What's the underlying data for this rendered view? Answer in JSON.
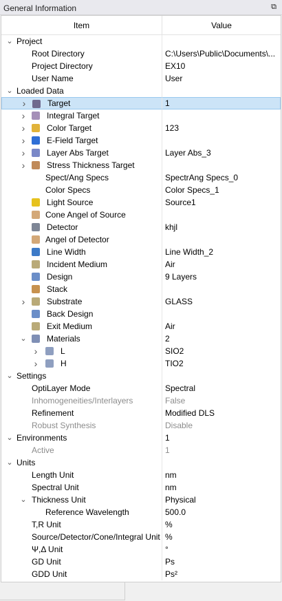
{
  "window": {
    "title": "General Information"
  },
  "columns": {
    "item": "Item",
    "value": "Value"
  },
  "rows": [
    {
      "level": 0,
      "chev": "down",
      "label": "Project",
      "value": ""
    },
    {
      "level": 1,
      "label": "Root Directory",
      "value": "C:\\Users\\Public\\Documents\\..."
    },
    {
      "level": 1,
      "label": "Project Directory",
      "value": "EX10"
    },
    {
      "level": 1,
      "label": "User Name",
      "value": "User"
    },
    {
      "level": 0,
      "chev": "down",
      "label": "Loaded Data",
      "value": ""
    },
    {
      "level": 1,
      "chev": "right",
      "icon": "target-icon",
      "icolor": "#6f6a8f",
      "label": "Target",
      "value": "1",
      "selected": true
    },
    {
      "level": 1,
      "chev": "right",
      "icon": "integral-target-icon",
      "icolor": "#a58fb8",
      "label": "Integral Target",
      "value": ""
    },
    {
      "level": 1,
      "chev": "right",
      "icon": "color-target-icon",
      "icolor": "#e1b33a",
      "label": "Color Target",
      "value": "123"
    },
    {
      "level": 1,
      "chev": "right",
      "icon": "e-field-target-icon",
      "icolor": "#2f6fd6",
      "label": "E-Field Target",
      "value": ""
    },
    {
      "level": 1,
      "chev": "right",
      "icon": "layer-abs-target-icon",
      "icolor": "#7a88c8",
      "label": "Layer Abs Target",
      "value": "Layer Abs_3"
    },
    {
      "level": 1,
      "chev": "right",
      "icon": "stress-thickness-target-icon",
      "icolor": "#c08a59",
      "label": "Stress Thickness Target",
      "value": ""
    },
    {
      "level": 2,
      "label": "Spect/Ang Specs",
      "value": "SpectrAng Specs_0"
    },
    {
      "level": 2,
      "label": "Color Specs",
      "value": "Color Specs_1"
    },
    {
      "level": 1,
      "icon": "light-source-icon",
      "icolor": "#e6c21e",
      "label": "Light Source",
      "value": "Source1"
    },
    {
      "level": 1,
      "icon": "cone-icon",
      "icolor": "#d3a878",
      "label": "Cone Angel of Source",
      "value": "",
      "shift": true
    },
    {
      "level": 1,
      "icon": "detector-icon",
      "icolor": "#7e8696",
      "label": "Detector",
      "value": "khjl"
    },
    {
      "level": 1,
      "icon": "cone-detector-icon",
      "icolor": "#d3a878",
      "label": "Angel of Detector",
      "value": "",
      "shift": true
    },
    {
      "level": 1,
      "icon": "line-width-icon",
      "icolor": "#3c7ac8",
      "label": "Line Width",
      "value": "Line Width_2"
    },
    {
      "level": 1,
      "icon": "incident-medium-icon",
      "icolor": "#b9aa78",
      "label": "Incident Medium",
      "value": "Air"
    },
    {
      "level": 1,
      "icon": "design-icon",
      "icolor": "#6b8ec8",
      "label": "Design",
      "value": "9 Layers"
    },
    {
      "level": 1,
      "icon": "stack-icon",
      "icolor": "#c7924f",
      "label": "Stack",
      "value": ""
    },
    {
      "level": 1,
      "chev": "right",
      "icon": "substrate-icon",
      "icolor": "#b9aa78",
      "label": "Substrate",
      "value": "GLASS"
    },
    {
      "level": 1,
      "icon": "back-design-icon",
      "icolor": "#6b8ec8",
      "label": "Back Design",
      "value": ""
    },
    {
      "level": 1,
      "icon": "exit-medium-icon",
      "icolor": "#b9aa78",
      "label": "Exit Medium",
      "value": "Air"
    },
    {
      "level": 1,
      "chev": "down",
      "icon": "materials-icon",
      "icolor": "#7f8fb5",
      "label": "Materials",
      "value": "2"
    },
    {
      "level": 2,
      "chev": "right",
      "icon": "material-icon",
      "icolor": "#8f9fc0",
      "label": "L",
      "value": "SIO2"
    },
    {
      "level": 2,
      "chev": "right",
      "icon": "material-icon",
      "icolor": "#8f9fc0",
      "label": "H",
      "value": "TIO2"
    },
    {
      "level": 0,
      "chev": "down",
      "label": "Settings",
      "value": ""
    },
    {
      "level": 1,
      "label": "OptiLayer Mode",
      "value": "Spectral"
    },
    {
      "level": 1,
      "label": "Inhomogeneities/Interlayers",
      "value": "False",
      "gray": true
    },
    {
      "level": 1,
      "label": "Refinement",
      "value": "Modified DLS"
    },
    {
      "level": 1,
      "label": "Robust Synthesis",
      "value": "Disable",
      "gray": true
    },
    {
      "level": 0,
      "chev": "down",
      "label": "Environments",
      "value": "1"
    },
    {
      "level": 1,
      "label": "Active",
      "value": "1",
      "gray": true
    },
    {
      "level": 0,
      "chev": "down",
      "label": "Units",
      "value": ""
    },
    {
      "level": 1,
      "label": "Length Unit",
      "value": "nm"
    },
    {
      "level": 1,
      "label": "Spectral Unit",
      "value": "nm"
    },
    {
      "level": 1,
      "chev": "down",
      "label": "Thickness Unit",
      "value": "Physical"
    },
    {
      "level": 2,
      "label": "Reference Wavelength",
      "value": "500.0"
    },
    {
      "level": 1,
      "label": "T,R Unit",
      "value": "%"
    },
    {
      "level": 1,
      "label": "Source/Detector/Cone/Integral Unit",
      "value": "%"
    },
    {
      "level": 1,
      "label": "Ψ,Δ Unit",
      "value": "°"
    },
    {
      "level": 1,
      "label": "GD Unit",
      "value": "Ps"
    },
    {
      "level": 1,
      "label": "GDD Unit",
      "value": "Ps²"
    }
  ]
}
